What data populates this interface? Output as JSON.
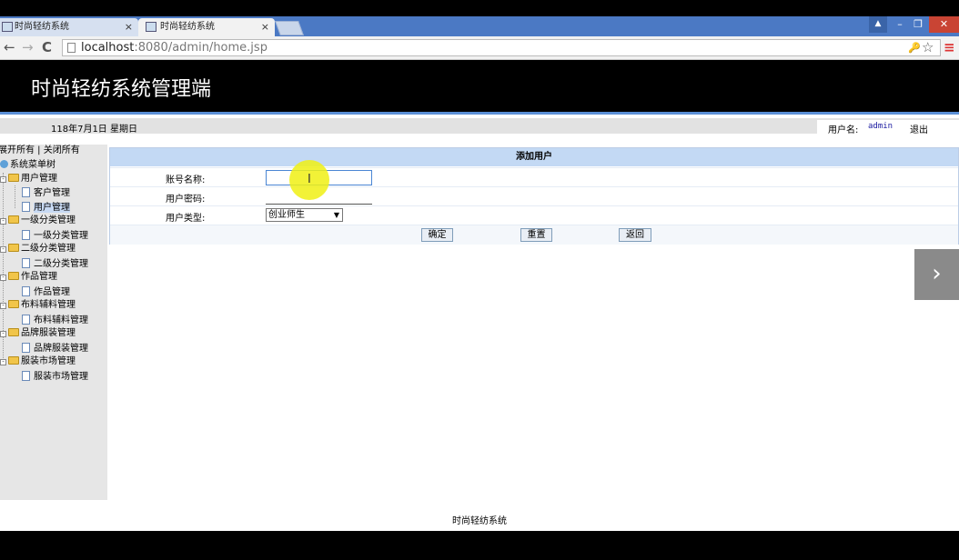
{
  "browser": {
    "tabs": [
      {
        "label": "时尚轻纺系统",
        "close": "×"
      },
      {
        "label": "时尚轻纺系统",
        "close": "×"
      }
    ],
    "url_host": "localhost",
    "url_rest": ":8080/admin/home.jsp",
    "back_icon": "←",
    "forward_icon": "→",
    "reload_icon": "C",
    "key_icon": "🔑",
    "star_icon": "☆",
    "menu_icon": "≡",
    "min_icon": "–",
    "max_icon": "❐",
    "close_icon": "✕",
    "user_icon": "▲"
  },
  "header": {
    "title": "时尚轻纺系统管理端"
  },
  "infobar": {
    "date": "118年7月1日 星期日",
    "user_label": "用户名:",
    "username": "admin",
    "logout": "退出"
  },
  "sidebar": {
    "expand_collapse": "展开所有 | 关闭所有",
    "root": "系统菜单树",
    "groups": [
      {
        "label": "用户管理",
        "items": [
          "客户管理",
          "用户管理"
        ]
      },
      {
        "label": "一级分类管理",
        "items": [
          "一级分类管理"
        ]
      },
      {
        "label": "二级分类管理",
        "items": [
          "二级分类管理"
        ]
      },
      {
        "label": "作品管理",
        "items": [
          "作品管理"
        ]
      },
      {
        "label": "布料辅料管理",
        "items": [
          "布料辅料管理"
        ]
      },
      {
        "label": "品牌服装管理",
        "items": [
          "品牌服装管理"
        ]
      },
      {
        "label": "服装市场管理",
        "items": [
          "服装市场管理"
        ]
      }
    ]
  },
  "form": {
    "title": "添加用户",
    "account_label": "账号名称:",
    "account_value": "",
    "password_label": "用户密码:",
    "type_label": "用户类型:",
    "type_selected": "创业师生",
    "confirm": "确定",
    "reset": "重置",
    "back": "返回"
  },
  "footer": {
    "text": "时尚轻纺系统"
  },
  "next_arrow": "›"
}
